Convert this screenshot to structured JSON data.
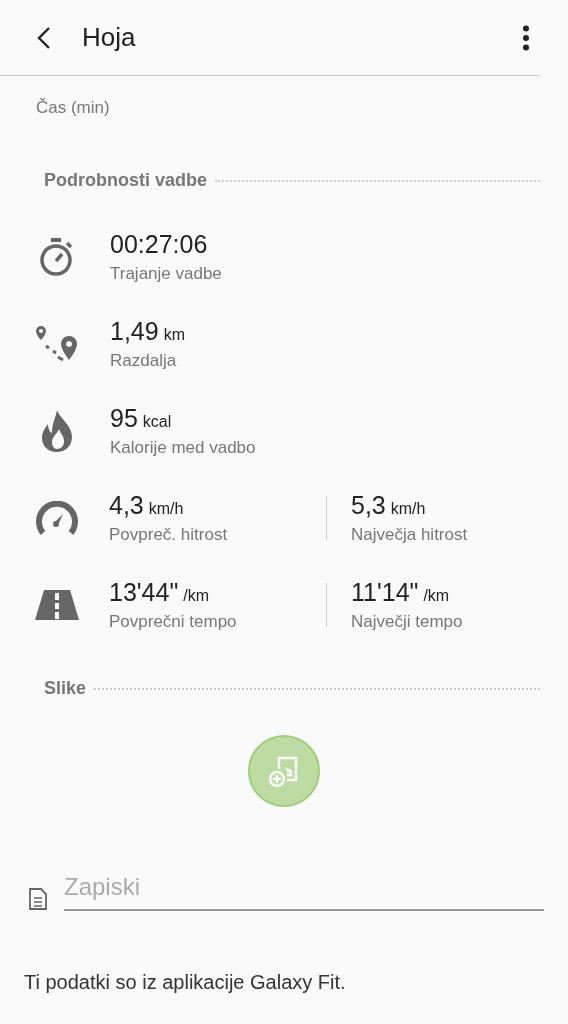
{
  "header": {
    "title": "Hoja"
  },
  "chart": {
    "xlabel": "Čas (min)"
  },
  "details": {
    "title": "Podrobnosti vadbe",
    "rows": [
      {
        "items": [
          {
            "value": "00:27:06",
            "label": "Trajanje vadbe"
          }
        ]
      },
      {
        "items": [
          {
            "value": "1,49",
            "unit": "km",
            "label": "Razdalja"
          }
        ]
      },
      {
        "items": [
          {
            "value": "95",
            "unit": "kcal",
            "label": "Kalorije med vadbo"
          }
        ]
      },
      {
        "items": [
          {
            "value": "4,3",
            "unit": "km/h",
            "label": "Povpreč. hitrost"
          },
          {
            "value": "5,3",
            "unit": "km/h",
            "label": "Največja hitrost"
          }
        ]
      },
      {
        "items": [
          {
            "value": "13'44\"",
            "unit": "/km",
            "label": "Povprečni tempo"
          },
          {
            "value": "11'14\"",
            "unit": "/km",
            "label": "Največji tempo"
          }
        ]
      }
    ]
  },
  "pictures": {
    "title": "Slike"
  },
  "notes": {
    "placeholder": "Zapiski"
  },
  "footer": "Ti podatki so iz aplikacije Galaxy Fit."
}
